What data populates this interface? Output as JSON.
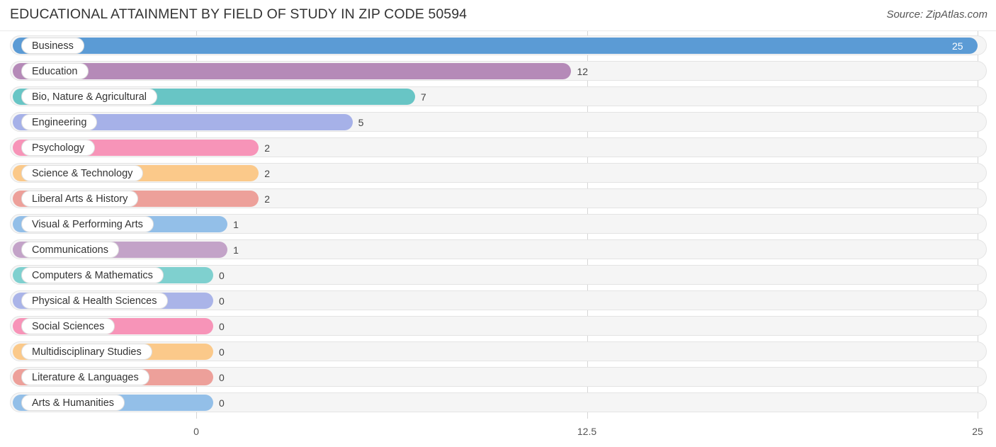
{
  "header": {
    "title": "EDUCATIONAL ATTAINMENT BY FIELD OF STUDY IN ZIP CODE 50594",
    "source": "Source: ZipAtlas.com"
  },
  "chart_data": {
    "type": "bar",
    "orientation": "horizontal",
    "title": "EDUCATIONAL ATTAINMENT BY FIELD OF STUDY IN ZIP CODE 50594",
    "xlabel": "",
    "ylabel": "",
    "xlim": [
      0,
      25
    ],
    "xticks": [
      "0",
      "12.5",
      "25"
    ],
    "xtick_values": [
      0,
      12.5,
      25
    ],
    "grid": true,
    "legend": false,
    "categories": [
      "Business",
      "Education",
      "Bio, Nature & Agricultural",
      "Engineering",
      "Psychology",
      "Science & Technology",
      "Liberal Arts & History",
      "Visual & Performing Arts",
      "Communications",
      "Computers & Mathematics",
      "Physical & Health Sciences",
      "Social Sciences",
      "Multidisciplinary Studies",
      "Literature & Languages",
      "Arts & Humanities"
    ],
    "values": [
      25,
      12,
      7,
      5,
      2,
      2,
      2,
      1,
      1,
      0,
      0,
      0,
      0,
      0,
      0
    ],
    "value_labels": [
      "25",
      "12",
      "7",
      "5",
      "2",
      "2",
      "2",
      "1",
      "1",
      "0",
      "0",
      "0",
      "0",
      "0",
      "0"
    ],
    "colors": [
      "#5b9bd5",
      "#b58ab8",
      "#68c5c5",
      "#a6b1e8",
      "#f794b8",
      "#fbc98a",
      "#eda09a",
      "#93bfe8",
      "#c3a3c8",
      "#7fd0cf",
      "#aab4e8",
      "#f794b8",
      "#fbc98a",
      "#eda09a",
      "#93bfe8"
    ]
  }
}
